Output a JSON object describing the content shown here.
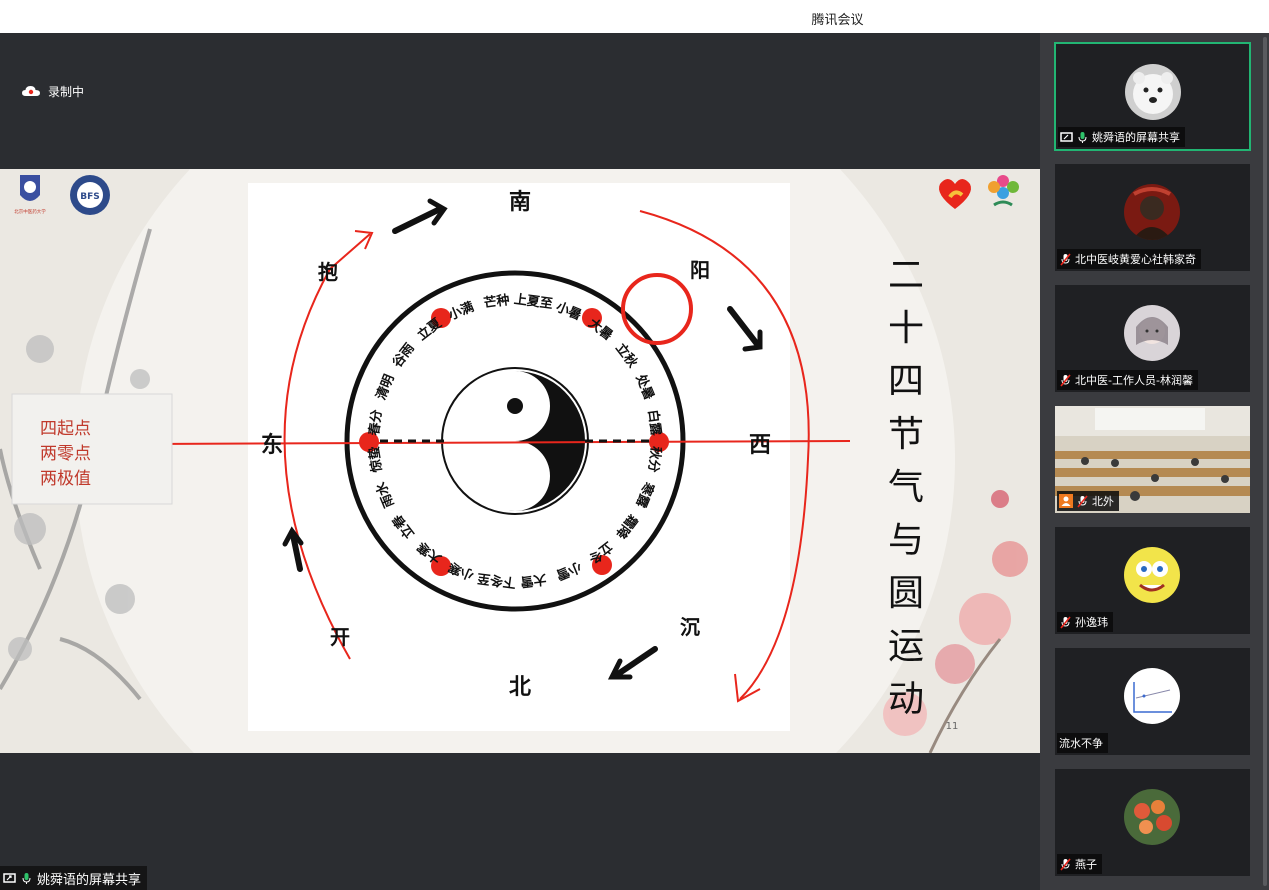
{
  "app": {
    "title": "腾讯会议"
  },
  "recording": {
    "label": "录制中"
  },
  "share_banner": {
    "label": "姚舜语的屏幕共享"
  },
  "slide": {
    "page_number": "11",
    "vertical_title": [
      "二",
      "十",
      "四",
      "节",
      "气",
      "与",
      "圆",
      "运",
      "动"
    ],
    "note_lines": [
      "四起点",
      "两零点",
      "两极值"
    ],
    "directions": {
      "south": "南",
      "north": "北",
      "east": "东",
      "west": "西"
    },
    "labels": {
      "yang": "阳",
      "kai": "开",
      "chen": "沉",
      "bao": "抱"
    },
    "terms": [
      "上夏至",
      "小暑",
      "大暑",
      "立秋",
      "处暑",
      "白露",
      "秋分",
      "寒露",
      "霜降",
      "立冬",
      "小雪",
      "大雪",
      "下冬至",
      "小寒",
      "大寒",
      "立春",
      "雨水",
      "惊蛰",
      "春分",
      "清明",
      "谷雨",
      "立夏",
      "小满",
      "芒种"
    ]
  },
  "participants": [
    {
      "name": "姚舜语的屏幕共享",
      "avatar": "polar-bear",
      "mic": "on",
      "sharing": true,
      "active": true
    },
    {
      "name": "北中医岐黄爱心社韩家奇",
      "avatar": "dark-portrait",
      "mic": "muted"
    },
    {
      "name": "北中医-工作人员-林润馨",
      "avatar": "girl-portrait",
      "mic": "muted"
    },
    {
      "name": "北外",
      "avatar": "classroom-video",
      "mic": "muted",
      "host_badge": true
    },
    {
      "name": "孙逸玮",
      "avatar": "sponge-character",
      "mic": "muted"
    },
    {
      "name": "流水不争",
      "avatar": "chart-thumbnail",
      "mic": "none"
    },
    {
      "name": "燕子",
      "avatar": "flowers",
      "mic": "muted"
    }
  ],
  "colors": {
    "accent_green": "#22b573",
    "red": "#e8261c",
    "mic_green": "#2ec26a"
  }
}
